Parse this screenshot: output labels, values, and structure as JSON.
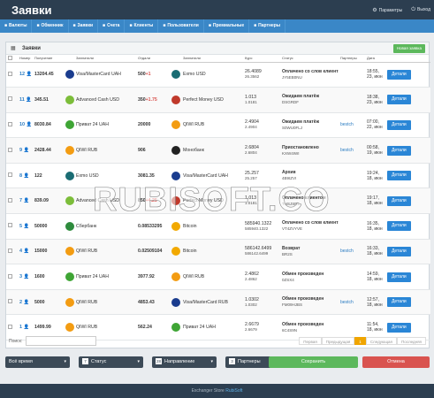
{
  "header": {
    "title": "Заявки",
    "params_label": "Параметры",
    "exit_label": "Выход"
  },
  "nav": [
    {
      "label": "Валюты",
      "icon": "coins-icon"
    },
    {
      "label": "Обменник",
      "icon": "exchange-icon"
    },
    {
      "label": "Заявки",
      "icon": "list-icon"
    },
    {
      "label": "Счета",
      "icon": "wallet-icon"
    },
    {
      "label": "Клиенты",
      "icon": "users-icon"
    },
    {
      "label": "Пользователи",
      "icon": "user-icon"
    },
    {
      "label": "Премиальные",
      "icon": "star-icon"
    },
    {
      "label": "Партнеры",
      "icon": "handshake-icon"
    }
  ],
  "panel": {
    "title": "Заявки",
    "new_button": "Новая заявка"
  },
  "columns": [
    "Номер",
    "Получение",
    "",
    "Заплатили",
    "Отдали",
    "",
    "Заплатили",
    "Курс",
    "Статус",
    "Партнеры",
    "Дата"
  ],
  "rows": [
    {
      "id": "12",
      "recv": "13204.45",
      "src_color": "#1a3c8e",
      "src_name": "Visa/MasterCard UAH",
      "give": "500",
      "give_extra": "+1",
      "dst_color": "#1a6c73",
      "dst_name": "Exmo USD",
      "rate1": "26.4089",
      "rate2": "26.3562",
      "status": "Оплачено со слов клиента",
      "sub": "JY5EB0NU",
      "partner": "",
      "date": "18:55, 23, июн"
    },
    {
      "id": "11",
      "recv": "345.51",
      "src_color": "#7cbd3a",
      "src_name": "Advanced Cash USD",
      "give": "350",
      "give_extra": "+1.75",
      "dst_color": "#c0392b",
      "dst_name": "Perfect Money USD",
      "rate1": "1.013",
      "rate2": "1.0181",
      "status": "Ожидаем платёж",
      "sub": "DSGRDF",
      "partner": "",
      "date": "18:38, 23, июн"
    },
    {
      "id": "10",
      "recv": "8030.84",
      "src_color": "#3fa535",
      "src_name": "Приват 24 UAH",
      "give": "20000",
      "give_extra": "",
      "dst_color": "#f39c12",
      "dst_name": "QIWI RUB",
      "rate1": "2.4904",
      "rate2": "2.4904",
      "status": "Ожидаем платёж",
      "sub": "S0WU0FLJ",
      "partner": "bestch",
      "date": "07:00, 22, июн"
    },
    {
      "id": "9",
      "recv": "2428.44",
      "src_color": "#f39c12",
      "src_name": "QIWI RUB",
      "give": "906",
      "give_extra": "",
      "dst_color": "#222",
      "dst_name": "Монобанк",
      "rate1": "2.6804",
      "rate2": "2.6804",
      "status": "Приостановлено",
      "sub": "KXW4IWI",
      "partner": "bestch",
      "date": "00:58, 19, июн"
    },
    {
      "id": "8",
      "recv": "122",
      "src_color": "#1a6c73",
      "src_name": "Exmo USD",
      "give": "3081.35",
      "give_extra": "",
      "dst_color": "#1a3c8e",
      "dst_name": "Visa/MasterCard UAH",
      "rate1": "25.257",
      "rate2": "25.257",
      "status": "Архив",
      "sub": "4B9IZVI",
      "partner": "",
      "date": "19:24, 18, июн"
    },
    {
      "id": "7",
      "recv": "839.09",
      "src_color": "#7cbd3a",
      "src_name": "Advanced Cash USD",
      "give": "850",
      "give_extra": "+4.25",
      "dst_color": "#c0392b",
      "dst_name": "Perfect Money USD",
      "rate1": "1.013",
      "rate2": "1.0181",
      "status": "Оплачено клиентом",
      "sub": "THSJSRL",
      "partner": "",
      "date": "19:17, 18, июн"
    },
    {
      "id": "5",
      "recv": "50000",
      "src_color": "#2e8b3d",
      "src_name": "Сбербанк",
      "give": "0.08533295",
      "give_extra": "",
      "dst_color": "#f2a900",
      "dst_name": "Bitcoin",
      "rate1": "585940.1322",
      "rate2": "585940.1322",
      "status": "Оплачено со слов клиента",
      "sub": "VT4ZVYVE",
      "partner": "",
      "date": "16:35, 18, июн"
    },
    {
      "id": "4",
      "recv": "15000",
      "src_color": "#f39c12",
      "src_name": "QIWI RUB",
      "give": "0.02509104",
      "give_extra": "",
      "dst_color": "#f2a900",
      "dst_name": "Bitcoin",
      "rate1": "586142.6499",
      "rate2": "586142.6499",
      "status": "Возврат",
      "sub": "BR2S",
      "partner": "bestch",
      "date": "16:33, 18, июн"
    },
    {
      "id": "3",
      "recv": "1600",
      "src_color": "#3fa535",
      "src_name": "Приват 24 UAH",
      "give": "3977.92",
      "give_extra": "",
      "dst_color": "#f39c12",
      "dst_name": "QIWI RUB",
      "rate1": "2.4862",
      "rate2": "2.4862",
      "status": "Обмен произведен",
      "sub": "0ZSX4",
      "partner": "",
      "date": "14:59, 18, июн"
    },
    {
      "id": "2",
      "recv": "5000",
      "src_color": "#f39c12",
      "src_name": "QIWI RUB",
      "give": "4853.43",
      "give_extra": "",
      "dst_color": "#1a3c8e",
      "dst_name": "Visa/MasterCard RUB",
      "rate1": "1.0302",
      "rate2": "1.0302",
      "status": "Обмен произведен",
      "sub": "FM09HJBS",
      "partner": "bestch",
      "date": "12:57, 18, июн"
    },
    {
      "id": "1",
      "recv": "1499.99",
      "src_color": "#f39c12",
      "src_name": "QIWI RUB",
      "give": "562.24",
      "give_extra": "",
      "dst_color": "#3fa535",
      "dst_name": "Приват 24 UAH",
      "rate1": "2.6679",
      "rate2": "2.6679",
      "status": "Обмен произведен",
      "sub": "6C4S9N",
      "partner": "",
      "date": "11:54, 18, июн"
    }
  ],
  "details_label": "Детали",
  "search": {
    "label": "Поиск:",
    "value": ""
  },
  "pager": [
    "Первая",
    "Предыдущая",
    "1",
    "Следующая",
    "Последняя"
  ],
  "filters": {
    "time": "Всё время",
    "status": "Статус",
    "direction": "Направление",
    "partners": "Партнеры",
    "status_icon": "7",
    "direction_icon": "28",
    "partners_icon": "3"
  },
  "save_label": "Сохранить",
  "cancel_label": "Отмена",
  "footer": {
    "text": "Exchanger Store",
    "brand": "RubiSoft"
  },
  "watermark": "RUBISOFT.CO"
}
